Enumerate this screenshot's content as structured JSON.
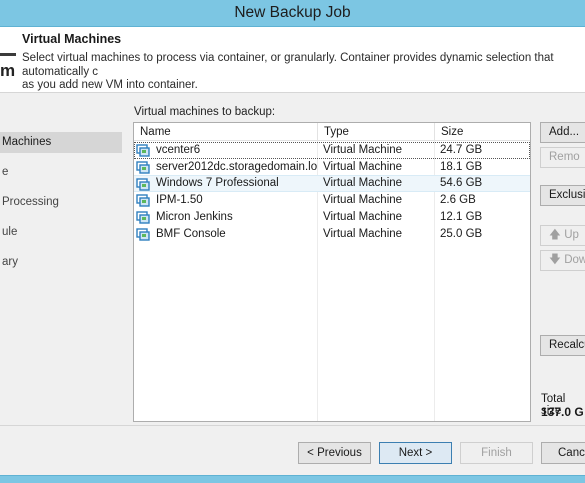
{
  "window": {
    "title": "New Backup Job"
  },
  "header": {
    "logo_text": "m",
    "title": "Virtual Machines",
    "description": "Select virtual machines to process via container, or granularly. Container provides dynamic selection that automatically c\nas you add new VM into container."
  },
  "nav": {
    "items": [
      {
        "label": "Machines"
      },
      {
        "label": "e"
      },
      {
        "label": "Processing"
      },
      {
        "label": "ule"
      },
      {
        "label": "ary"
      }
    ]
  },
  "vm_list": {
    "label": "Virtual machines to backup:",
    "columns": [
      "Name",
      "Type",
      "Size"
    ],
    "rows": [
      {
        "name": "vcenter6",
        "type": "Virtual Machine",
        "size": "24.7 GB"
      },
      {
        "name": "server2012dc.storagedomain.lo...",
        "type": "Virtual Machine",
        "size": "18.1 GB"
      },
      {
        "name": "Windows 7 Professional",
        "type": "Virtual Machine",
        "size": "54.6 GB"
      },
      {
        "name": "IPM-1.50",
        "type": "Virtual Machine",
        "size": "2.6 GB"
      },
      {
        "name": "Micron Jenkins",
        "type": "Virtual Machine",
        "size": "12.1 GB"
      },
      {
        "name": "BMF Console",
        "type": "Virtual Machine",
        "size": "25.0 GB"
      }
    ]
  },
  "side_buttons": {
    "add": "Add...",
    "remove": "Remo",
    "exclusions": "Exclusio",
    "up": "Up",
    "down": "Dow",
    "recalculate": "Recalcu"
  },
  "total": {
    "label": "Total size",
    "value": "137.0 G"
  },
  "footer": {
    "previous": "< Previous",
    "next": "Next >",
    "finish": "Finish",
    "cancel": "Canc"
  },
  "colors": {
    "titlebar": "#7cc6e3",
    "selection": "#d6d6d6",
    "vm_icon": "#2f7fbf",
    "vm_icon_accent": "#5cb85c"
  }
}
